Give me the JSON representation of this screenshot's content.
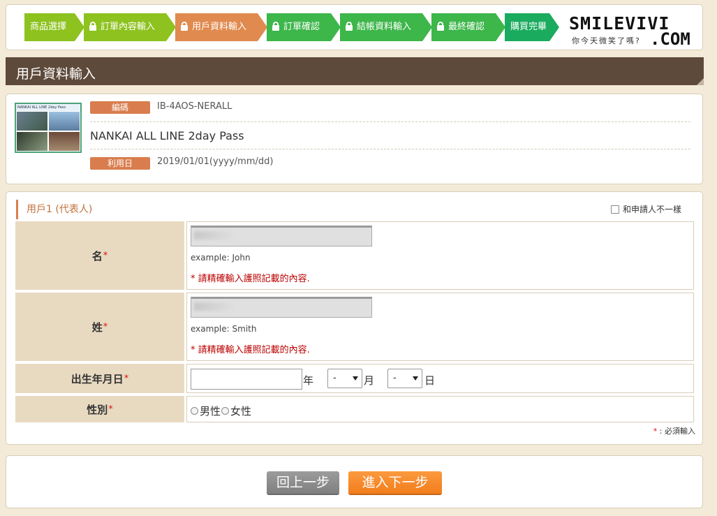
{
  "steps": [
    {
      "label": "商品選擇",
      "color": "#8dc21f",
      "lock": false
    },
    {
      "label": "訂單內容輸入",
      "color": "#8dc21f",
      "lock": true
    },
    {
      "label": "用戶資料輸入",
      "color": "#e08a4f",
      "lock": true
    },
    {
      "label": "訂單確認",
      "color": "#3db64a",
      "lock": true
    },
    {
      "label": "結帳資料輸入",
      "color": "#3db64a",
      "lock": true
    },
    {
      "label": "最終確認",
      "color": "#3db64a",
      "lock": true
    },
    {
      "label": "購買完畢",
      "color": "#1aab5e",
      "lock": false
    }
  ],
  "logo": {
    "main": "SMILEVIVI",
    "sub": "你今天微笑了嗎?",
    "suffix": ".COM"
  },
  "page_title": "用戶資料輸入",
  "product": {
    "thumb_caption": "NANKAI ALL LINE 2day Pass",
    "code_label": "編碼",
    "code": "IB-4AOS-NERALL",
    "name": "NANKAI ALL LINE 2day Pass",
    "date_label": "利用日",
    "date": "2019/01/01(yyyy/mm/dd)"
  },
  "user": {
    "heading": "用戶1 (代表人)",
    "diff_applicant_label": "和申請人不一樣",
    "first_name_label": "名",
    "first_name_example": "example: John",
    "first_name_warning": "* 請精確輸入護照記載的內容.",
    "last_name_label": "姓",
    "last_name_example": "example: Smith",
    "last_name_warning": "* 請精確輸入護照記載的內容.",
    "birth_label": "出生年月日",
    "year_unit": "年",
    "month_value": "-",
    "month_unit": "月",
    "day_value": "-",
    "day_unit": "日",
    "gender_label": "性別",
    "gender_male": "男性",
    "gender_female": "女性",
    "required_star": "*",
    "required_note": ": 必須輸入"
  },
  "buttons": {
    "back": "回上一步",
    "next": "進入下一步"
  }
}
